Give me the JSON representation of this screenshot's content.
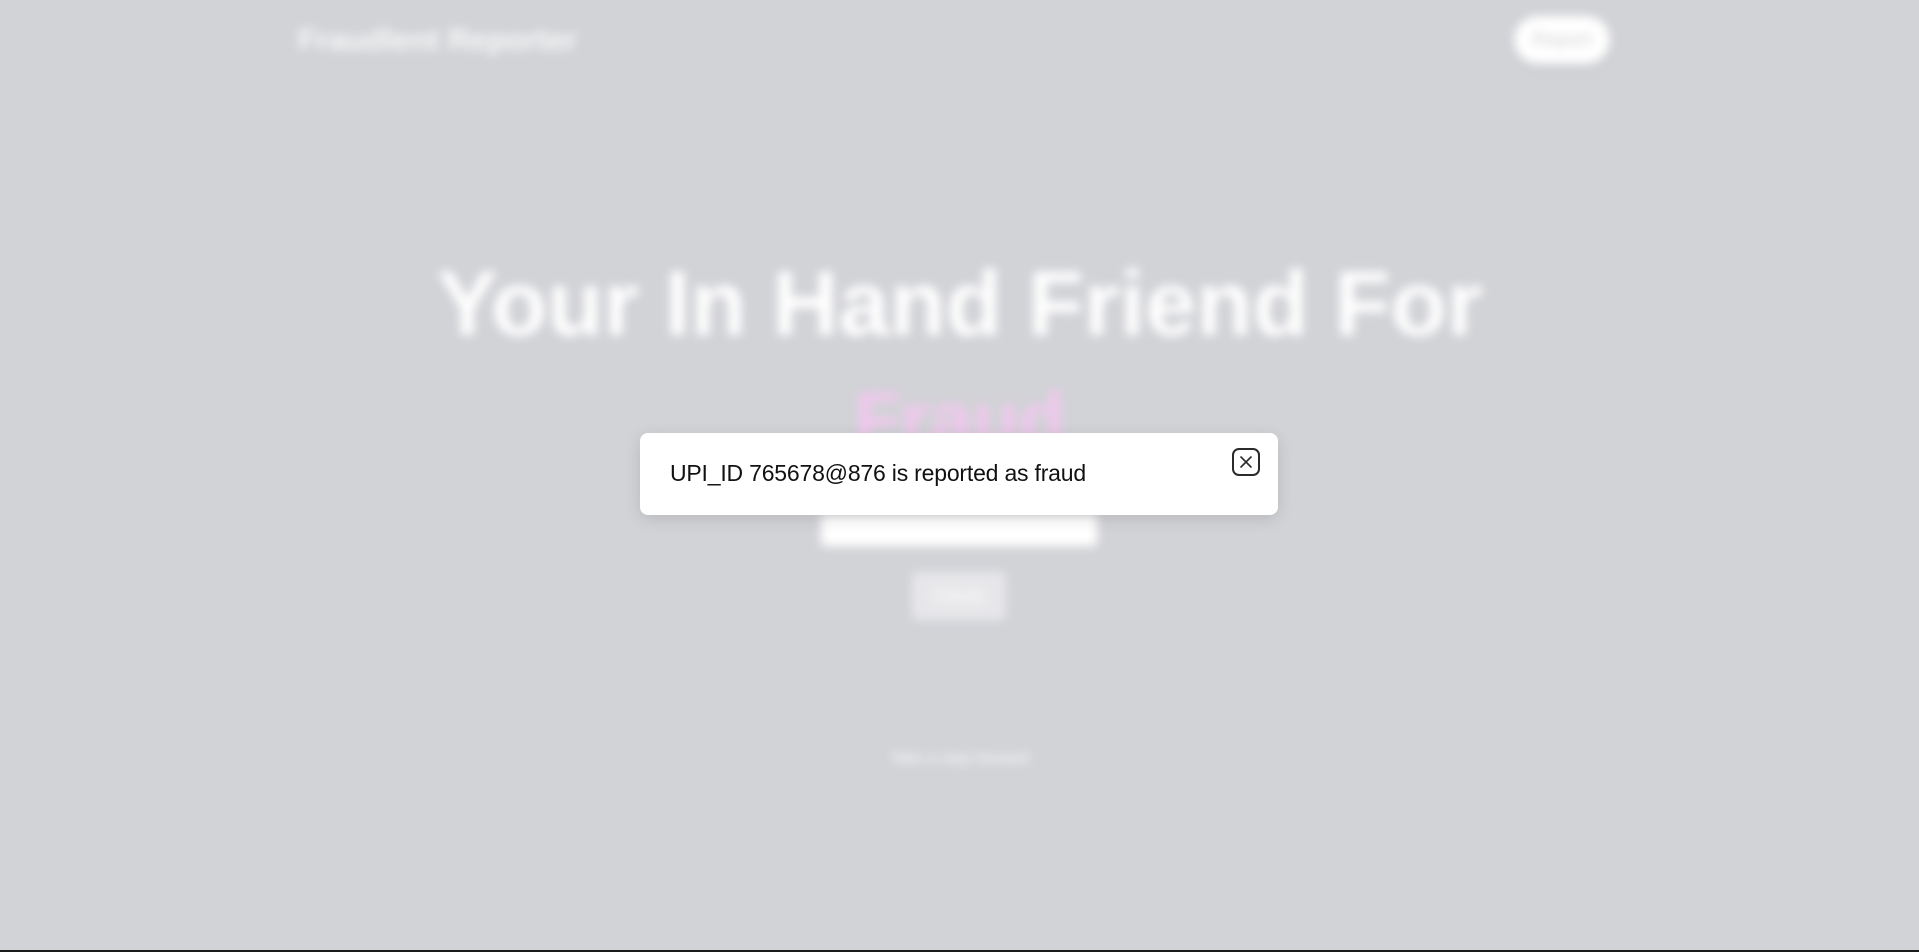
{
  "nav": {
    "brand": "Fraudlent Reporter",
    "report_button": "Report"
  },
  "hero": {
    "title": "Your In Hand Friend For",
    "highlight": "Fraud"
  },
  "form": {
    "input_value": "",
    "check_button": "Check"
  },
  "footer": {
    "tagline": "Take a step forward"
  },
  "modal": {
    "message": "UPI_ID 765678@876 is reported as fraud",
    "close_icon": "close-icon"
  },
  "colors": {
    "background": "#d2d3d7",
    "highlight": "#f0c7ee",
    "modal_bg": "#ffffff",
    "text": "#111111"
  }
}
